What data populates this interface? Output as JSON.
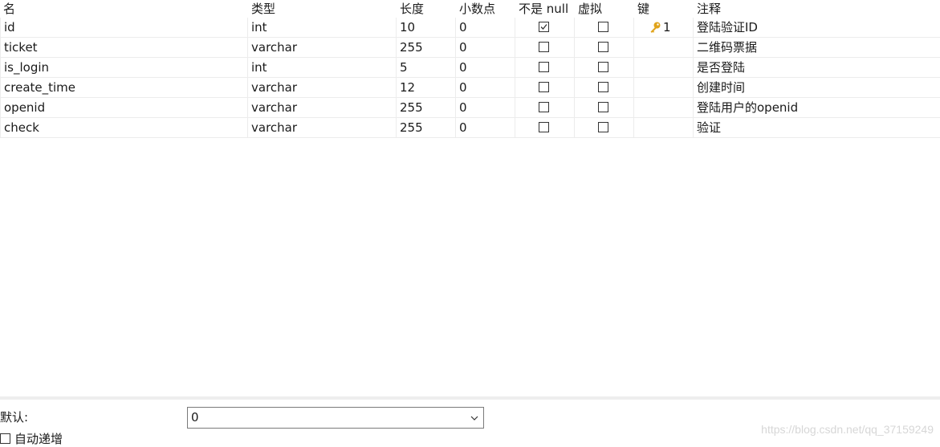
{
  "columns": {
    "name": "名",
    "type": "类型",
    "length": "长度",
    "decimals": "小数点",
    "not_null": "不是 null",
    "virtual": "虚拟",
    "key": "键",
    "comment": "注释"
  },
  "rows": [
    {
      "name": "id",
      "type": "int",
      "length": "10",
      "decimals": "0",
      "not_null": true,
      "virtual": false,
      "key": "1",
      "comment": "登陆验证ID"
    },
    {
      "name": "ticket",
      "type": "varchar",
      "length": "255",
      "decimals": "0",
      "not_null": false,
      "virtual": false,
      "key": "",
      "comment": "二维码票据"
    },
    {
      "name": "is_login",
      "type": "int",
      "length": "5",
      "decimals": "0",
      "not_null": false,
      "virtual": false,
      "key": "",
      "comment": "是否登陆"
    },
    {
      "name": "create_time",
      "type": "varchar",
      "length": "12",
      "decimals": "0",
      "not_null": false,
      "virtual": false,
      "key": "",
      "comment": "创建时间"
    },
    {
      "name": "openid",
      "type": "varchar",
      "length": "255",
      "decimals": "0",
      "not_null": false,
      "virtual": false,
      "key": "",
      "comment": "登陆用户的openid"
    },
    {
      "name": "check",
      "type": "varchar",
      "length": "255",
      "decimals": "0",
      "not_null": false,
      "virtual": false,
      "key": "",
      "comment": "验证"
    }
  ],
  "props": {
    "default_label": "默认:",
    "default_value": "0",
    "auto_increment_label": "自动递增",
    "auto_increment_checked": false
  },
  "watermark": "https://blog.csdn.net/qq_37159249",
  "colors": {
    "key_icon": "#e0a31a",
    "grid_line": "#ececec"
  }
}
